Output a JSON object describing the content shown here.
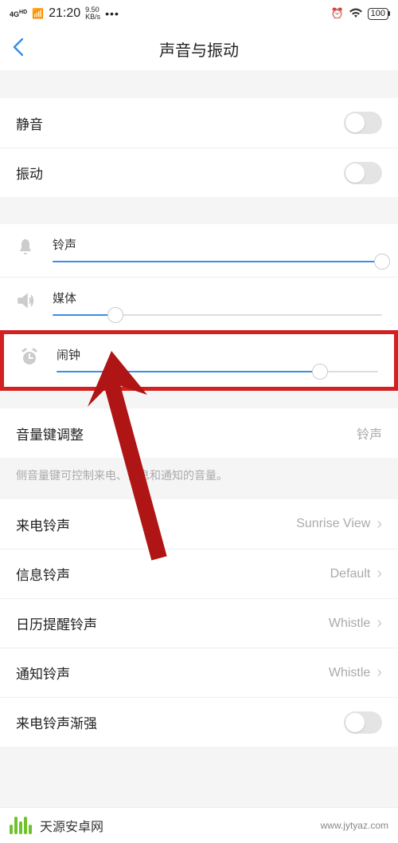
{
  "status_bar": {
    "network": "4G HD",
    "time": "21:20",
    "speed_top": "9.50",
    "speed_bottom": "KB/s",
    "dots": "•••",
    "battery": "100"
  },
  "nav": {
    "title": "声音与振动"
  },
  "toggles": {
    "mute_label": "静音",
    "vibrate_label": "振动"
  },
  "sliders": {
    "ring": {
      "label": "铃声",
      "percent": 100
    },
    "media": {
      "label": "媒体",
      "percent": 19
    },
    "alarm": {
      "label": "闹钟",
      "percent": 82
    }
  },
  "volume_key": {
    "label": "音量键调整",
    "value": "铃声",
    "helper": "侧音量键可控制来电、信息和通知的音量。"
  },
  "ringtones": {
    "incoming": {
      "label": "来电铃声",
      "value": "Sunrise View"
    },
    "message": {
      "label": "信息铃声",
      "value": "Default"
    },
    "calendar": {
      "label": "日历提醒铃声",
      "value": "Whistle"
    },
    "notification": {
      "label": "通知铃声",
      "value": "Whistle"
    },
    "crescendo": {
      "label": "来电铃声渐强"
    }
  },
  "watermark": {
    "text": "天源安卓网",
    "url": "www.jytyaz.com"
  }
}
